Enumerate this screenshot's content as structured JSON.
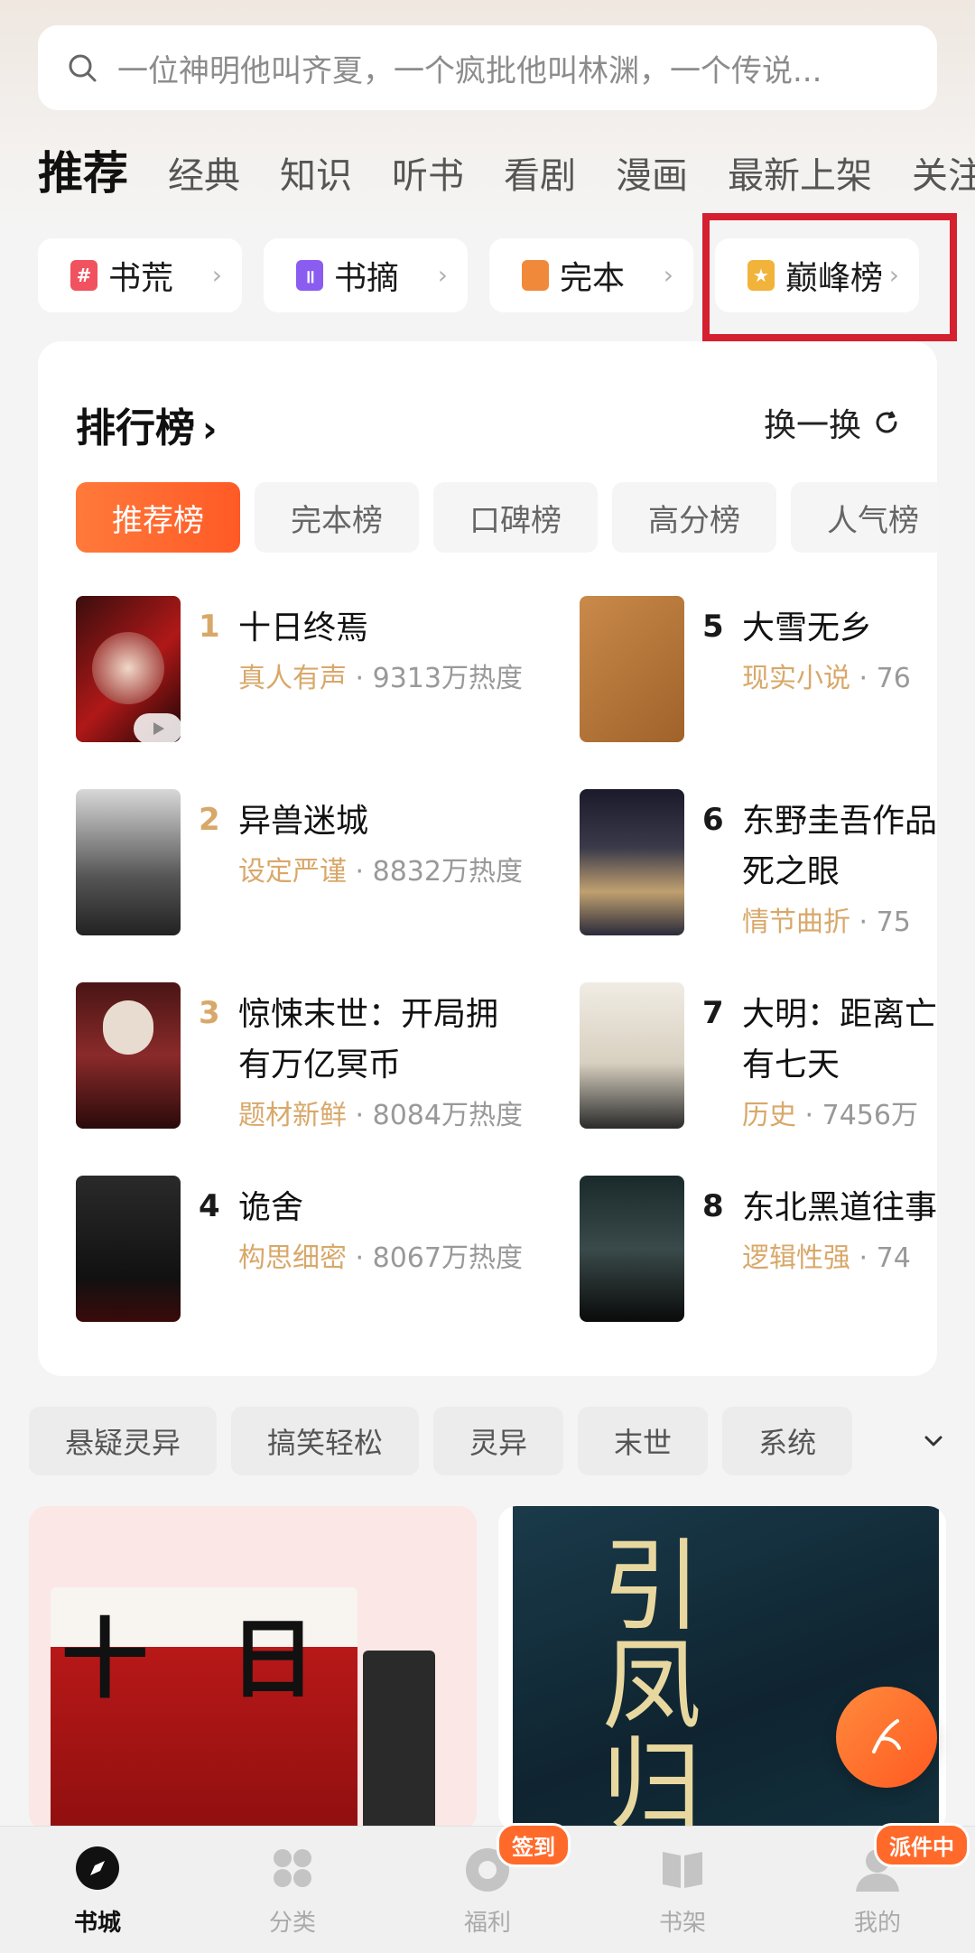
{
  "search": {
    "placeholder": "一位神明他叫齐夏，一个疯批他叫林渊，一个传说..."
  },
  "top_tabs": [
    "推荐",
    "经典",
    "知识",
    "听书",
    "看剧",
    "漫画",
    "最新上架",
    "关注"
  ],
  "quick_entries": [
    {
      "label": "书荒",
      "icon": "hash-icon",
      "color": "#f0525f"
    },
    {
      "label": "书摘",
      "icon": "bookmark-icon",
      "color": "#8a5cf0"
    },
    {
      "label": "完本",
      "icon": "book-icon",
      "color": "#f08a3a"
    },
    {
      "label": "巅峰榜",
      "icon": "trophy-icon",
      "color": "#f2b33a"
    }
  ],
  "ranking": {
    "title": "排行榜",
    "refresh_label": "换一换",
    "tabs": [
      "推荐榜",
      "完本榜",
      "口碑榜",
      "高分榜",
      "人气榜"
    ],
    "books": [
      {
        "rank": "1",
        "title": "十日终焉",
        "tag": "真人有声",
        "heat": " · 9313万热度",
        "rank_color": "#d8a86a"
      },
      {
        "rank": "2",
        "title": "异兽迷城",
        "tag": "设定严谨",
        "heat": " · 8832万热度",
        "rank_color": "#d8a86a"
      },
      {
        "rank": "3",
        "title": "惊悚末世：开局拥有万亿冥币",
        "tag": "题材新鲜",
        "heat": " · 8084万热度",
        "rank_color": "#d8a86a"
      },
      {
        "rank": "4",
        "title": "诡舍",
        "tag": "构思细密",
        "heat": " · 8067万热度",
        "rank_color": "#1a1a1a"
      },
      {
        "rank": "5",
        "title": "大雪无乡",
        "tag": "现实小说",
        "heat": " · 76",
        "rank_color": "#1a1a1a"
      },
      {
        "rank": "6",
        "title": "东野圭吾作品：濒死之眼",
        "tag": "情节曲折",
        "heat": " · 75",
        "rank_color": "#1a1a1a"
      },
      {
        "rank": "7",
        "title": "大明：距离亡国还有七天",
        "tag": "历史",
        "heat": " · 7456万",
        "rank_color": "#1a1a1a"
      },
      {
        "rank": "8",
        "title": "东北黑道往事",
        "tag": "逻辑性强",
        "heat": " · 74",
        "rank_color": "#1a1a1a"
      }
    ]
  },
  "genres": [
    "悬疑灵异",
    "搞笑轻松",
    "灵异",
    "末世",
    "系统"
  ],
  "promo": {
    "left_title": "十日",
    "right_title": "引凤归"
  },
  "bottom_nav": [
    {
      "label": "书城",
      "icon": "compass-icon"
    },
    {
      "label": "分类",
      "icon": "grid-icon"
    },
    {
      "label": "福利",
      "icon": "coin-icon",
      "badge": "签到"
    },
    {
      "label": "书架",
      "icon": "bookshelf-icon"
    },
    {
      "label": "我的",
      "icon": "user-icon",
      "badge": "派件中"
    }
  ],
  "colors": {
    "accent": "#ff5a26",
    "highlight_border": "#d4202f",
    "tag_gold": "#d8a86a"
  }
}
